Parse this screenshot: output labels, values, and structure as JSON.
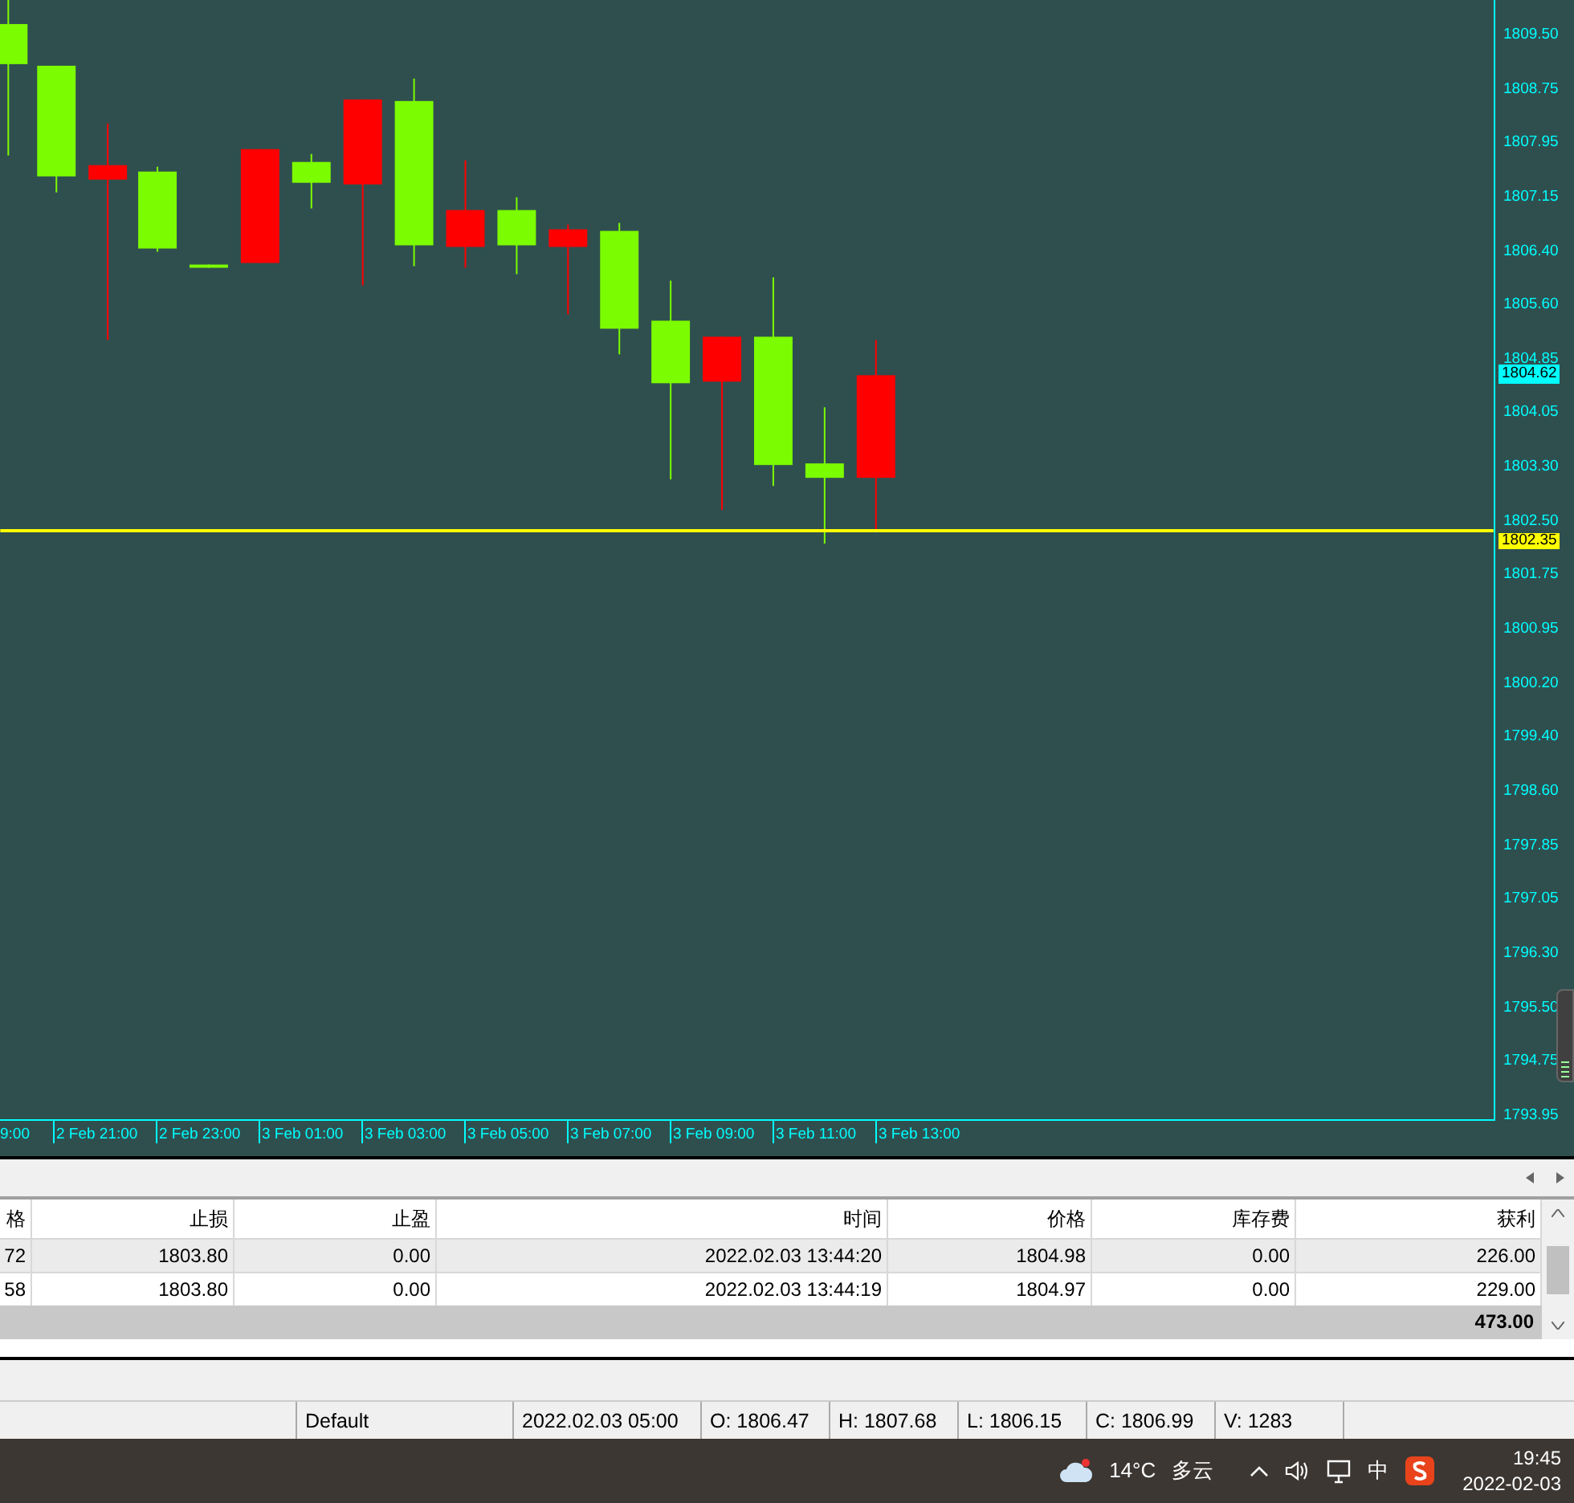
{
  "chart": {
    "price_labels": [
      "1809.50",
      "1808.75",
      "1807.95",
      "1807.15",
      "1806.40",
      "1805.60",
      "1804.85",
      "1804.05",
      "1803.30",
      "1802.50",
      "1801.75",
      "1800.95",
      "1800.20",
      "1799.40",
      "1798.60",
      "1797.85",
      "1797.05",
      "1796.30",
      "1795.50",
      "1794.75",
      "1793.95"
    ],
    "bid_label": "1804.62",
    "last_label": "1802.35",
    "time_labels": [
      "9:00",
      "2 Feb 21:00",
      "2 Feb 23:00",
      "3 Feb 01:00",
      "3 Feb 03:00",
      "3 Feb 05:00",
      "3 Feb 07:00",
      "3 Feb 09:00",
      "3 Feb 11:00",
      "3 Feb 13:00"
    ]
  },
  "table": {
    "columns": [
      "格",
      "止损",
      "止盈",
      "时间",
      "价格",
      "库存费",
      "获利"
    ],
    "rows": [
      {
        "cells": [
          "72",
          "1803.80",
          "0.00",
          "2022.02.03 13:44:20",
          "1804.98",
          "0.00",
          "226.00"
        ]
      },
      {
        "cells": [
          "58",
          "1803.80",
          "0.00",
          "2022.02.03 13:44:19",
          "1804.97",
          "0.00",
          "229.00"
        ]
      }
    ],
    "total": "473.00"
  },
  "status_bar": [
    "Default",
    "2022.02.03 05:00",
    "O: 1806.47",
    "H: 1807.68",
    "L: 1806.15",
    "C: 1806.99",
    "V: 1283"
  ],
  "taskbar": {
    "temperature": "14°C",
    "weather": "多云",
    "ime": "中",
    "time": "19:45",
    "date": "2022-02-03"
  }
}
